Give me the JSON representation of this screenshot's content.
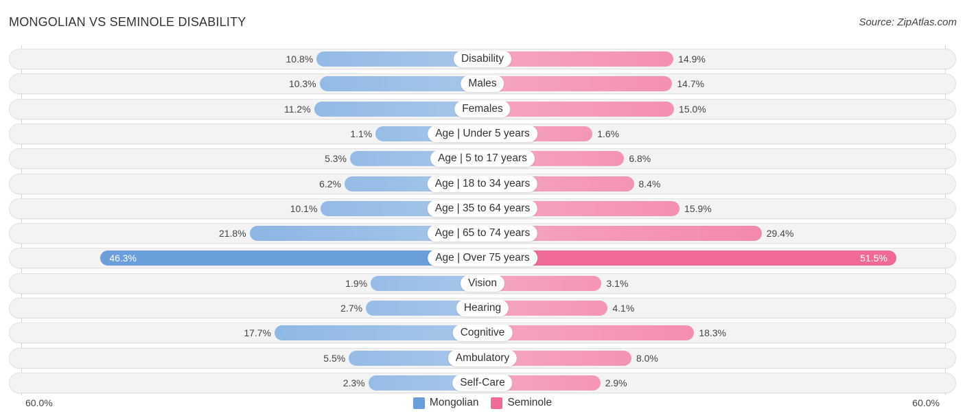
{
  "header": {
    "title": "MONGOLIAN VS SEMINOLE DISABILITY",
    "source": "Source: ZipAtlas.com"
  },
  "colors": {
    "mongolian": "#6a9fdb",
    "mongolian_light": "#a7c7ea",
    "seminole": "#f06a96",
    "seminole_light": "#f6a6c0"
  },
  "chart_data": {
    "type": "bar",
    "orientation": "horizontal-diverging",
    "title": "MONGOLIAN VS SEMINOLE DISABILITY",
    "source": "Source: ZipAtlas.com",
    "categories": [
      "Disability",
      "Males",
      "Females",
      "Age | Under 5 years",
      "Age | 5 to 17 years",
      "Age | 18 to 34 years",
      "Age | 35 to 64 years",
      "Age | 65 to 74 years",
      "Age | Over 75 years",
      "Vision",
      "Hearing",
      "Cognitive",
      "Ambulatory",
      "Self-Care"
    ],
    "series": [
      {
        "name": "Mongolian",
        "side": "left",
        "values": [
          10.8,
          10.3,
          11.2,
          1.1,
          5.3,
          6.2,
          10.1,
          21.8,
          46.3,
          1.9,
          2.7,
          17.7,
          5.5,
          2.3
        ],
        "labels": [
          "10.8%",
          "10.3%",
          "11.2%",
          "1.1%",
          "5.3%",
          "6.2%",
          "10.1%",
          "21.8%",
          "46.3%",
          "1.9%",
          "2.7%",
          "17.7%",
          "5.5%",
          "2.3%"
        ]
      },
      {
        "name": "Seminole",
        "side": "right",
        "values": [
          14.9,
          14.7,
          15.0,
          1.6,
          6.8,
          8.4,
          15.9,
          29.4,
          51.5,
          3.1,
          4.1,
          18.3,
          8.0,
          2.9
        ],
        "labels": [
          "14.9%",
          "14.7%",
          "15.0%",
          "1.6%",
          "6.8%",
          "8.4%",
          "15.9%",
          "29.4%",
          "51.5%",
          "3.1%",
          "4.1%",
          "18.3%",
          "8.0%",
          "2.9%"
        ]
      }
    ],
    "unit": "%",
    "xlim": [
      0,
      60
    ],
    "axis_labels": {
      "left": "60.0%",
      "right": "60.0%"
    },
    "legend": {
      "position": "bottom-center",
      "entries": [
        "Mongolian",
        "Seminole"
      ]
    },
    "grid": false
  }
}
